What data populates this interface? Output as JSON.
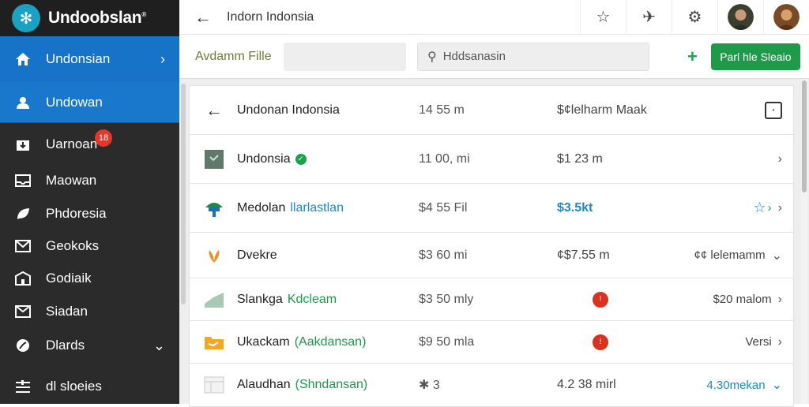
{
  "app": {
    "brand_name": "Undoobslan",
    "brand_mark": "®"
  },
  "sidebar": {
    "items": [
      {
        "label": "Undonsian",
        "icon": "home-icon",
        "active": true,
        "chevron": "›"
      },
      {
        "label": "Undowan",
        "icon": "user-icon",
        "active": true
      },
      {
        "label": "Uarnoan",
        "icon": "download-icon",
        "badge": "18"
      },
      {
        "label": "Maowan",
        "icon": "inbox-icon"
      },
      {
        "label": "Phdoresia",
        "icon": "leaf-icon"
      },
      {
        "label": "Geokoks",
        "icon": "mail-icon"
      },
      {
        "label": "Godiaik",
        "icon": "building-icon"
      },
      {
        "label": "Siadan",
        "icon": "envelope-icon"
      },
      {
        "label": "Dlards",
        "icon": "globe-icon",
        "chevron": "⌄"
      },
      {
        "label": "dl sloeies",
        "icon": "settings-lines-icon"
      }
    ]
  },
  "topbar": {
    "back": "←",
    "title": "Indorn Indonsia"
  },
  "toolbar": {
    "file_label": "Avdamm Fille",
    "search_placeholder": "Hddsanasin",
    "add_symbol": "+",
    "primary_label": "Parl hle Sleaio"
  },
  "rows": [
    {
      "icon": "back-arrow-icon",
      "name": "Undonan Indonsia",
      "sub": "",
      "size": "14 55 m",
      "price": "$¢lelharm Maak",
      "meta": "",
      "meta_icon": "square-icon"
    },
    {
      "icon": "grid-icon",
      "name": "Undonsia",
      "sub": "",
      "size": "11 00, mi",
      "price": "$1 23 m",
      "meta": "",
      "chevron": "›",
      "dot": "green"
    },
    {
      "icon": "umbrella-icon",
      "name": "Medolan",
      "sub": "llarlastlan",
      "size": "$4 55 Fil",
      "price": "$3.5kt",
      "meta": "",
      "chevron": "›",
      "meta_icon": "star-outline-icon"
    },
    {
      "icon": "leaf-icon",
      "name": "Dvekre",
      "sub": "",
      "size": "$3 60 mi",
      "price": "¢$7.55 m",
      "meta": "¢¢ lelemamm",
      "chevron": "⌄"
    },
    {
      "icon": "chart-icon",
      "name": "Slankga",
      "sub": "Kdcleam",
      "size": "$3 50 mly",
      "price": "",
      "meta": "$20 malom",
      "chevron": "›",
      "dot": "red"
    },
    {
      "icon": "folder-icon",
      "name": "Ukackam",
      "sub": "(Aakdansan)",
      "size": "$9 50 mla",
      "price": "",
      "meta": "Versi",
      "chevron": "›",
      "dot": "red"
    },
    {
      "icon": "table-icon",
      "name": "Alaudhan",
      "sub": "(Shndansan)",
      "size": "✱ 3",
      "price": "4.2 38 mirl",
      "meta": "4.30mekan",
      "chevron": "⌄"
    }
  ],
  "colors": {
    "sidebar_bg": "#2b2b2b",
    "active_blue": "#1673c8",
    "accent_green": "#1f9a4b",
    "link_blue": "#1a88c9",
    "badge_red": "#e2382a"
  }
}
